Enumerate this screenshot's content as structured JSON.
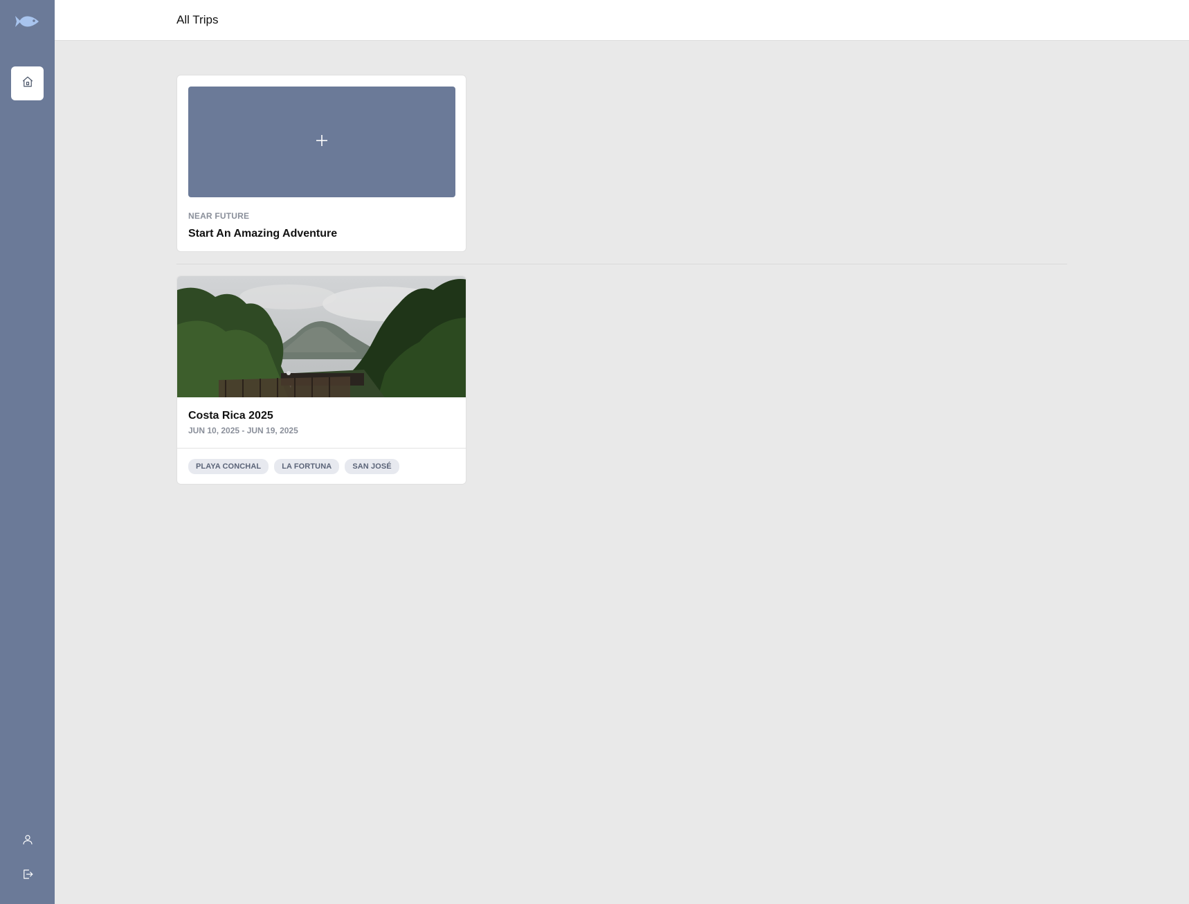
{
  "app": {
    "logo_icon": "fish-icon",
    "brand_color": "#6b7a98",
    "logo_color": "#a8c4ee"
  },
  "sidebar": {
    "items": [
      {
        "icon": "home-icon",
        "active": true
      },
      {
        "icon": "user-icon",
        "active": false
      },
      {
        "icon": "logout-icon",
        "active": false
      }
    ]
  },
  "header": {
    "title": "All Trips"
  },
  "new_trip": {
    "icon": "plus-icon",
    "eyebrow": "NEAR FUTURE",
    "title": "Start An Amazing Adventure"
  },
  "trips": [
    {
      "title": "Costa Rica 2025",
      "dates": "JUN 10, 2025 - JUN 19, 2025",
      "tags": [
        "PLAYA CONCHAL",
        "LA FORTUNA",
        "SAN JOSÉ"
      ]
    }
  ]
}
